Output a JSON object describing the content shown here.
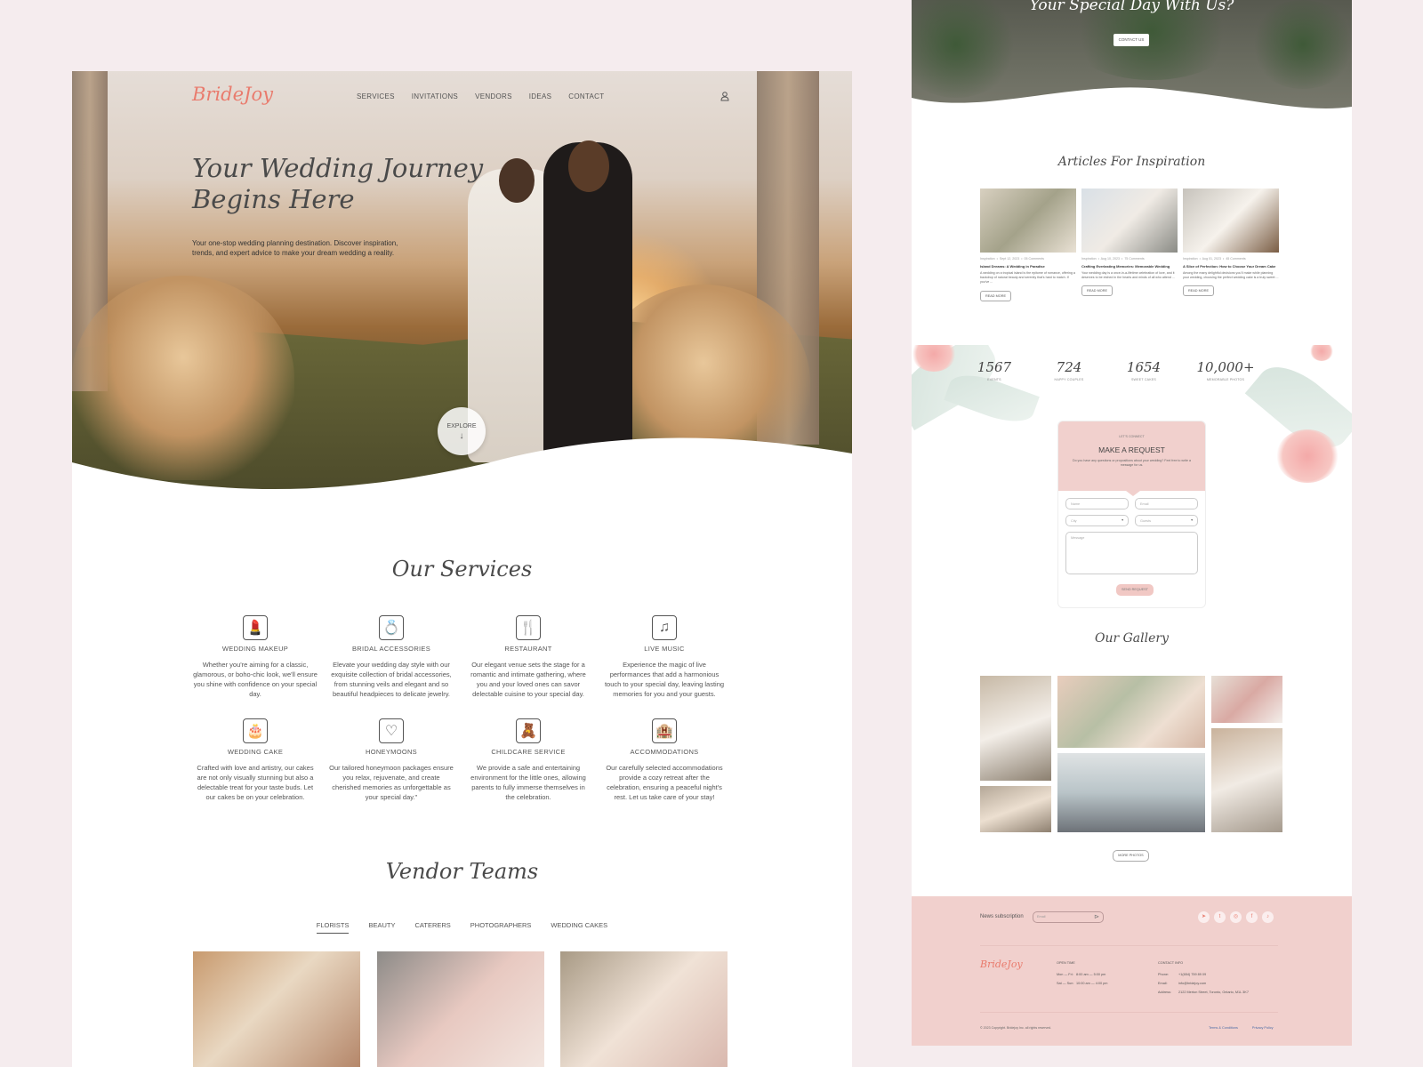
{
  "brand": {
    "logo": "BrideJoy",
    "accent": "#e97b6d",
    "pink_bg": "#f1d0cd"
  },
  "nav": {
    "items": [
      "SERVICES",
      "INVITATIONS",
      "VENDORS",
      "IDEAS",
      "CONTACT"
    ],
    "user_icon": "user-icon"
  },
  "hero": {
    "title": "Your Wedding Journey Begins Here",
    "text": "Your one-stop wedding planning destination. Discover inspiration, trends, and expert advice to make your dream wedding a reality.",
    "explore_label": "EXPLORE",
    "explore_icon": "arrow-down-icon"
  },
  "services": {
    "title": "Our Services",
    "items": [
      {
        "name": "WEDDING  MAKEUP",
        "icon": "makeup-icon",
        "glyph": "💄",
        "desc": "Whether you're aiming for a classic, glamorous, or boho-chic look, we'll ensure you shine with confidence on your special day."
      },
      {
        "name": "BRIDAL ACCESSORIES",
        "icon": "jewelry-icon",
        "glyph": "💍",
        "desc": "Elevate your wedding day style with our exquisite collection of bridal accessories, from stunning veils and elegant and so beautiful headpieces to delicate jewelry."
      },
      {
        "name": "RESTAURANT",
        "icon": "cutlery-icon",
        "glyph": "🍴",
        "desc": "Our elegant venue sets the stage for a romantic and intimate gathering, where you and your loved ones can savor delectable cuisine to your special day."
      },
      {
        "name": "LIVE MUSIC",
        "icon": "music-notes-icon",
        "glyph": "♫",
        "desc": "Experience the magic of live performances that add a harmonious touch to your special day, leaving lasting memories for you and your guests."
      },
      {
        "name": "WEDDING  CAKE",
        "icon": "cake-icon",
        "glyph": "🎂",
        "desc": "Crafted with love and artistry, our cakes are not only visually stunning but also a delectable treat for your taste buds. Let our cakes be on your celebration."
      },
      {
        "name": "HONEYMOONS",
        "icon": "heart-bed-icon",
        "glyph": "♡",
        "desc": "Our tailored honeymoon packages ensure you relax, rejuvenate, and create cherished memories as unforgettable as your special day.\""
      },
      {
        "name": "CHILDCARE SERVICE",
        "icon": "teddy-bear-icon",
        "glyph": "🧸",
        "desc": "We provide a safe and entertaining environment for the little ones, allowing parents to fully immerse themselves in the celebration."
      },
      {
        "name": "ACCOMMODATIONS",
        "icon": "hotel-icon",
        "glyph": "🏨",
        "desc": "Our carefully selected accommodations provide a cozy retreat after the celebration, ensuring a peaceful night's rest. Let us take care of your stay!"
      }
    ]
  },
  "vendors": {
    "title": "Vendor Teams",
    "tabs": [
      "FLORISTS",
      "BEAUTY",
      "CATERERS",
      "PHOTOGRAPHERS",
      "WEDDING CAKES"
    ],
    "active_tab": "FLORISTS"
  },
  "cta": {
    "title": "Your Special Day With Us?",
    "button": "CONTACT US"
  },
  "articles": {
    "title": "Articles For Inspiration",
    "items": [
      {
        "category": "Inspiration",
        "date": "Sept 12, 2023",
        "comments": "05 Comments",
        "title": "Island Dreams: A Wedding in Paradise",
        "excerpt": "A wedding on a tropical island is the epitome of romance, offering a backdrop of natural beauty and serenity that's hard to match. If you've ...",
        "button": "READ MORE"
      },
      {
        "category": "Inspiration",
        "date": "Aug 10, 2023",
        "comments": "75 Comments",
        "title": "Crafting Everlasting Memories: Memorable Wedding",
        "excerpt": "Your wedding day is a once-in-a-lifetime celebration of love, and it deserves to be etched in the hearts and minds of all who attend ...",
        "button": "READ MORE"
      },
      {
        "category": "Inspiration",
        "date": "Aug 01, 2023",
        "comments": "45 Comments",
        "title": "A Slice of Perfection: How to Choose Your Dream Cake",
        "excerpt": "Among the many delightful decisions you'll make while planning your wedding, choosing the perfect wedding cake is a truly sweet ...",
        "button": "READ MORE"
      }
    ]
  },
  "stats": [
    {
      "value": "1567",
      "label": "EVENTS"
    },
    {
      "value": "724",
      "label": "HAPPY COUPLES"
    },
    {
      "value": "1654",
      "label": "SWEET CAKES"
    },
    {
      "value": "10,000+",
      "label": "MEMORABLE PHOTOS"
    }
  ],
  "form": {
    "eyebrow": "LET'S CONNECT",
    "title": "MAKE A REQUEST",
    "subtitle": "Do you have any questions or propositions about your wedding? Feel free to write a message for us.",
    "name_placeholder": "Name",
    "email_placeholder": "Email",
    "city_placeholder": "City",
    "guests_placeholder": "Guests",
    "message_placeholder": "Message",
    "submit": "SEND REQUEST"
  },
  "gallery": {
    "title": "Our Gallery",
    "more_button": "MORE PHOTOS"
  },
  "footer": {
    "news_label": "News subscription",
    "email_placeholder": "Email",
    "social": [
      {
        "icon": "telegram-icon",
        "glyph": "➤"
      },
      {
        "icon": "twitter-icon",
        "glyph": "t"
      },
      {
        "icon": "instagram-icon",
        "glyph": "◎"
      },
      {
        "icon": "facebook-icon",
        "glyph": "f"
      },
      {
        "icon": "tiktok-icon",
        "glyph": "♪"
      }
    ],
    "logo": "BrideJoy",
    "open_time": {
      "heading": "OPEN TIME",
      "rows": [
        [
          "Mon — Fri:",
          "8:00 am — 5:00 pm"
        ],
        [
          "Sat — Sun:",
          "10:00 am — 4:00 pm"
        ]
      ]
    },
    "contact": {
      "heading": "CONTACT INFO",
      "rows": [
        [
          "Phone:",
          "+1(654) 759 89 09"
        ],
        [
          "Email:",
          "info@bridejoy.com"
        ],
        [
          "Address:",
          "2122 Merton Street, Toronto, Ontario, M1L 3K7"
        ]
      ]
    },
    "copyright": "© 2023 Copyright. Bridejoy Inc. all rights reserved.",
    "links": [
      "Terms & Conditions",
      "Privacy Policy"
    ]
  }
}
